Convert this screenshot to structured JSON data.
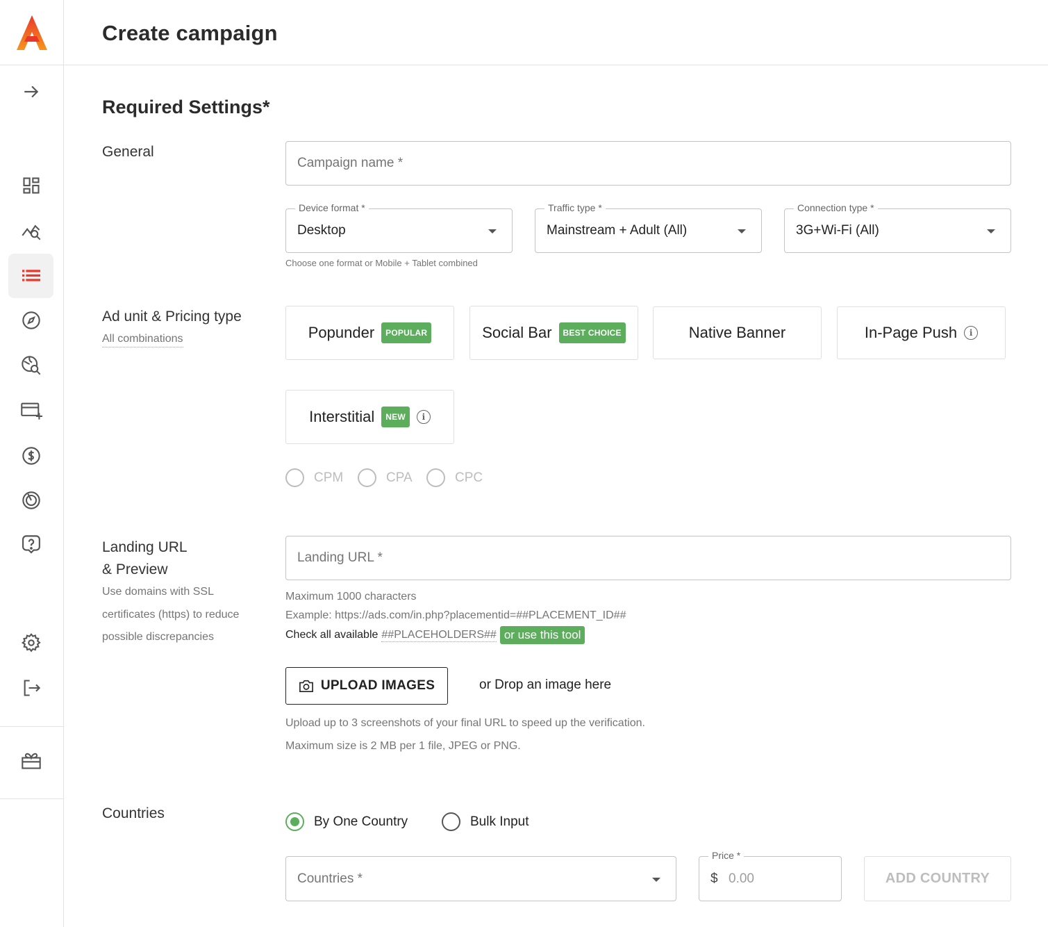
{
  "header": {
    "title": "Create campaign"
  },
  "sidebar": {
    "items": [
      {
        "icon": "arrow-right-icon"
      },
      {
        "icon": "dashboard-icon"
      },
      {
        "icon": "statistics-icon"
      },
      {
        "icon": "campaigns-list-icon",
        "active": true
      },
      {
        "icon": "compass-icon"
      },
      {
        "icon": "globe-search-icon"
      },
      {
        "icon": "add-payment-icon"
      },
      {
        "icon": "dollar-icon"
      },
      {
        "icon": "target-icon"
      },
      {
        "icon": "help-icon"
      },
      {
        "icon": "gear-icon"
      },
      {
        "icon": "logout-icon"
      },
      {
        "icon": "gift-icon"
      }
    ]
  },
  "required": {
    "title": "Required Settings*"
  },
  "general": {
    "label": "General",
    "campaign_name_placeholder": "Campaign name *",
    "device_format": {
      "label": "Device format *",
      "value": "Desktop",
      "hint": "Choose one format or Mobile + Tablet combined"
    },
    "traffic_type": {
      "label": "Traffic type *",
      "value": "Mainstream + Adult (All)"
    },
    "connection_type": {
      "label": "Connection type *",
      "value": "3G+Wi-Fi (All)"
    }
  },
  "ad_unit": {
    "label": "Ad unit & Pricing type",
    "link": "All combinations",
    "units": [
      {
        "name": "Popunder",
        "badge": "POPULAR"
      },
      {
        "name": "Social Bar",
        "badge": "BEST CHOICE"
      },
      {
        "name": "Native Banner"
      },
      {
        "name": "In-Page Push",
        "info": "i"
      },
      {
        "name": "Interstitial",
        "badge": "NEW",
        "info": "i"
      }
    ],
    "pricing": [
      "CPM",
      "CPA",
      "CPC"
    ]
  },
  "landing": {
    "label_line1": "Landing URL",
    "label_line2": "& Preview",
    "desc_line1": "Use domains with SSL",
    "desc_line2": "certificates (https) to reduce",
    "desc_line3": "possible discrepancies",
    "url_placeholder": "Landing URL *",
    "max_chars": "Maximum 1000 characters",
    "example": "Example: https://ads.com/in.php?placementid=##PLACEMENT_ID##",
    "check_prefix": "Check all available",
    "placeholders_link": "##PLACEHOLDERS##",
    "tool_link": "or use this tool",
    "upload_label": "UPLOAD IMAGES",
    "drop_text": "or Drop an image here",
    "upload_hint1": "Upload up to 3 screenshots of your final URL to speed up the verification.",
    "upload_hint2": "Maximum size is 2 MB per 1 file, JPEG or PNG."
  },
  "countries": {
    "label": "Countries",
    "mode_one": "By One Country",
    "mode_bulk": "Bulk Input",
    "selected_mode": "By One Country",
    "countries_placeholder": "Countries *",
    "price_label": "Price *",
    "price_currency": "$",
    "price_placeholder": "0.00",
    "add_button": "ADD COUNTRY"
  },
  "colors": {
    "accent_green": "#5cae5d",
    "brand_red": "#e8382b",
    "brand_orange": "#f7941d"
  }
}
